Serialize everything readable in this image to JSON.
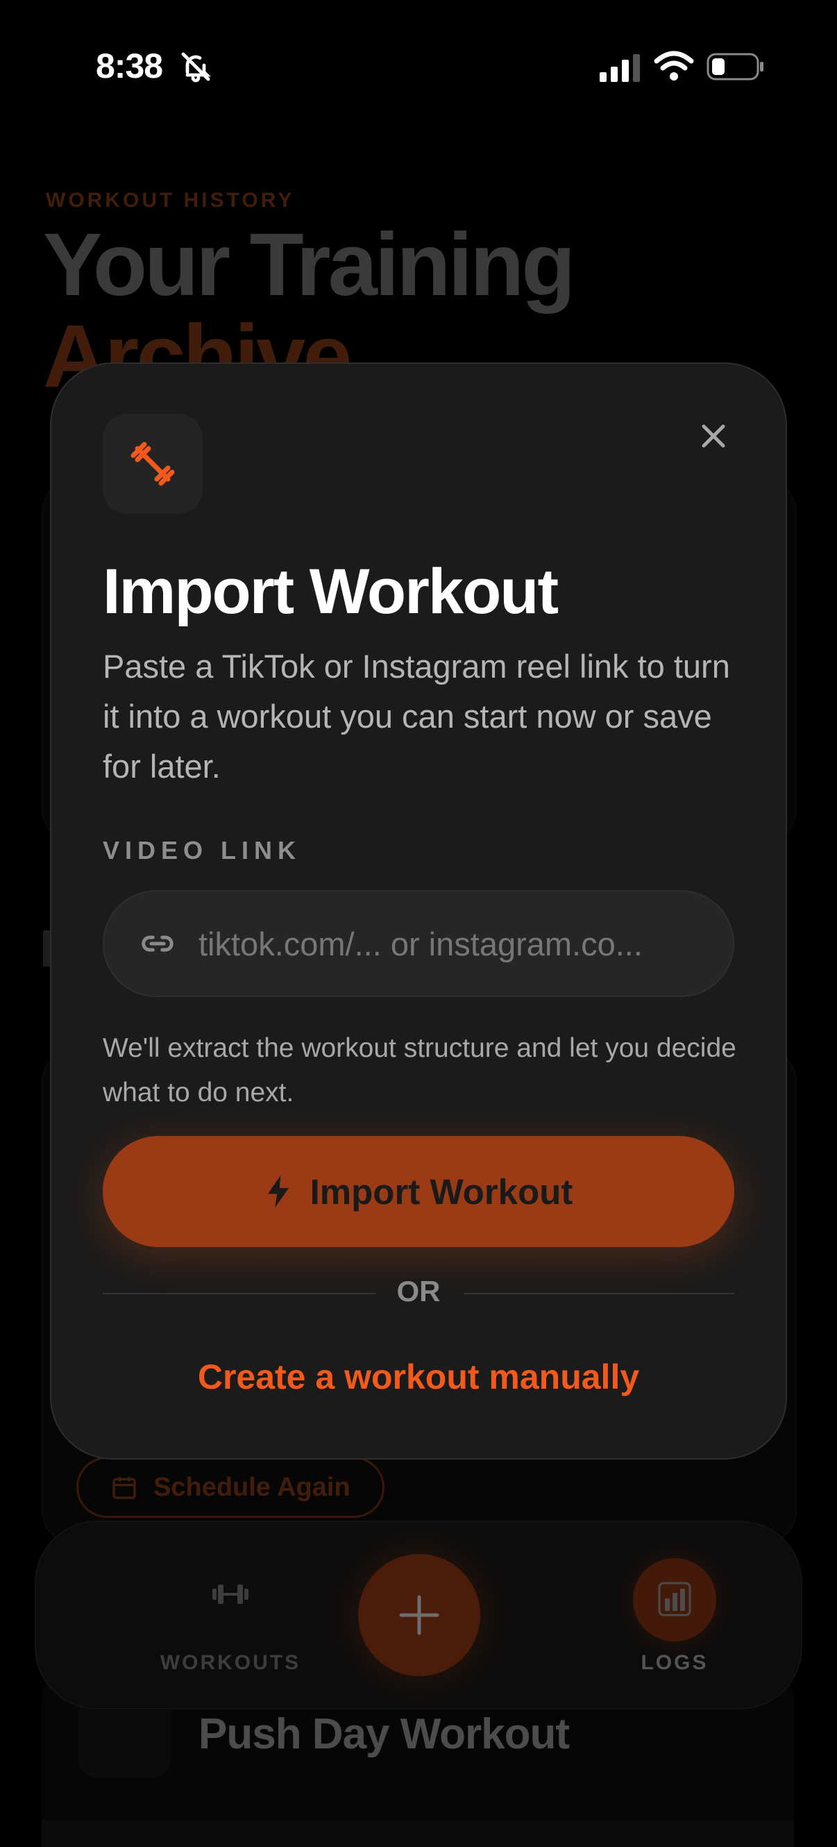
{
  "status_bar": {
    "time": "8:38",
    "icons": [
      "bell-slash-icon",
      "signal-icon",
      "wifi-icon",
      "battery-icon"
    ]
  },
  "background": {
    "eyebrow": "WORKOUT HISTORY",
    "title_line1": "Your Training",
    "title_line2": "Archive",
    "schedule_again": "Schedule Again",
    "push_title": "Push Day Workout"
  },
  "tabbar": {
    "workouts_label": "WORKOUTS",
    "logs_label": "LOGS",
    "fab_icon": "plus-icon"
  },
  "modal": {
    "title": "Import Workout",
    "description": "Paste a TikTok or Instagram reel link to turn it into a workout you can start now or save for later.",
    "field_label": "VIDEO LINK",
    "input_placeholder": "tiktok.com/... or instagram.co...",
    "input_value": "",
    "hint": "We'll extract the workout structure and let you decide what to do next.",
    "import_button": "Import Workout",
    "or_text": "OR",
    "manual_link": "Create a workout manually"
  },
  "colors": {
    "accent": "#f2591d",
    "accent_dark": "#9a3b15",
    "modal_bg": "#1b1b1b",
    "page_bg": "#000000"
  }
}
